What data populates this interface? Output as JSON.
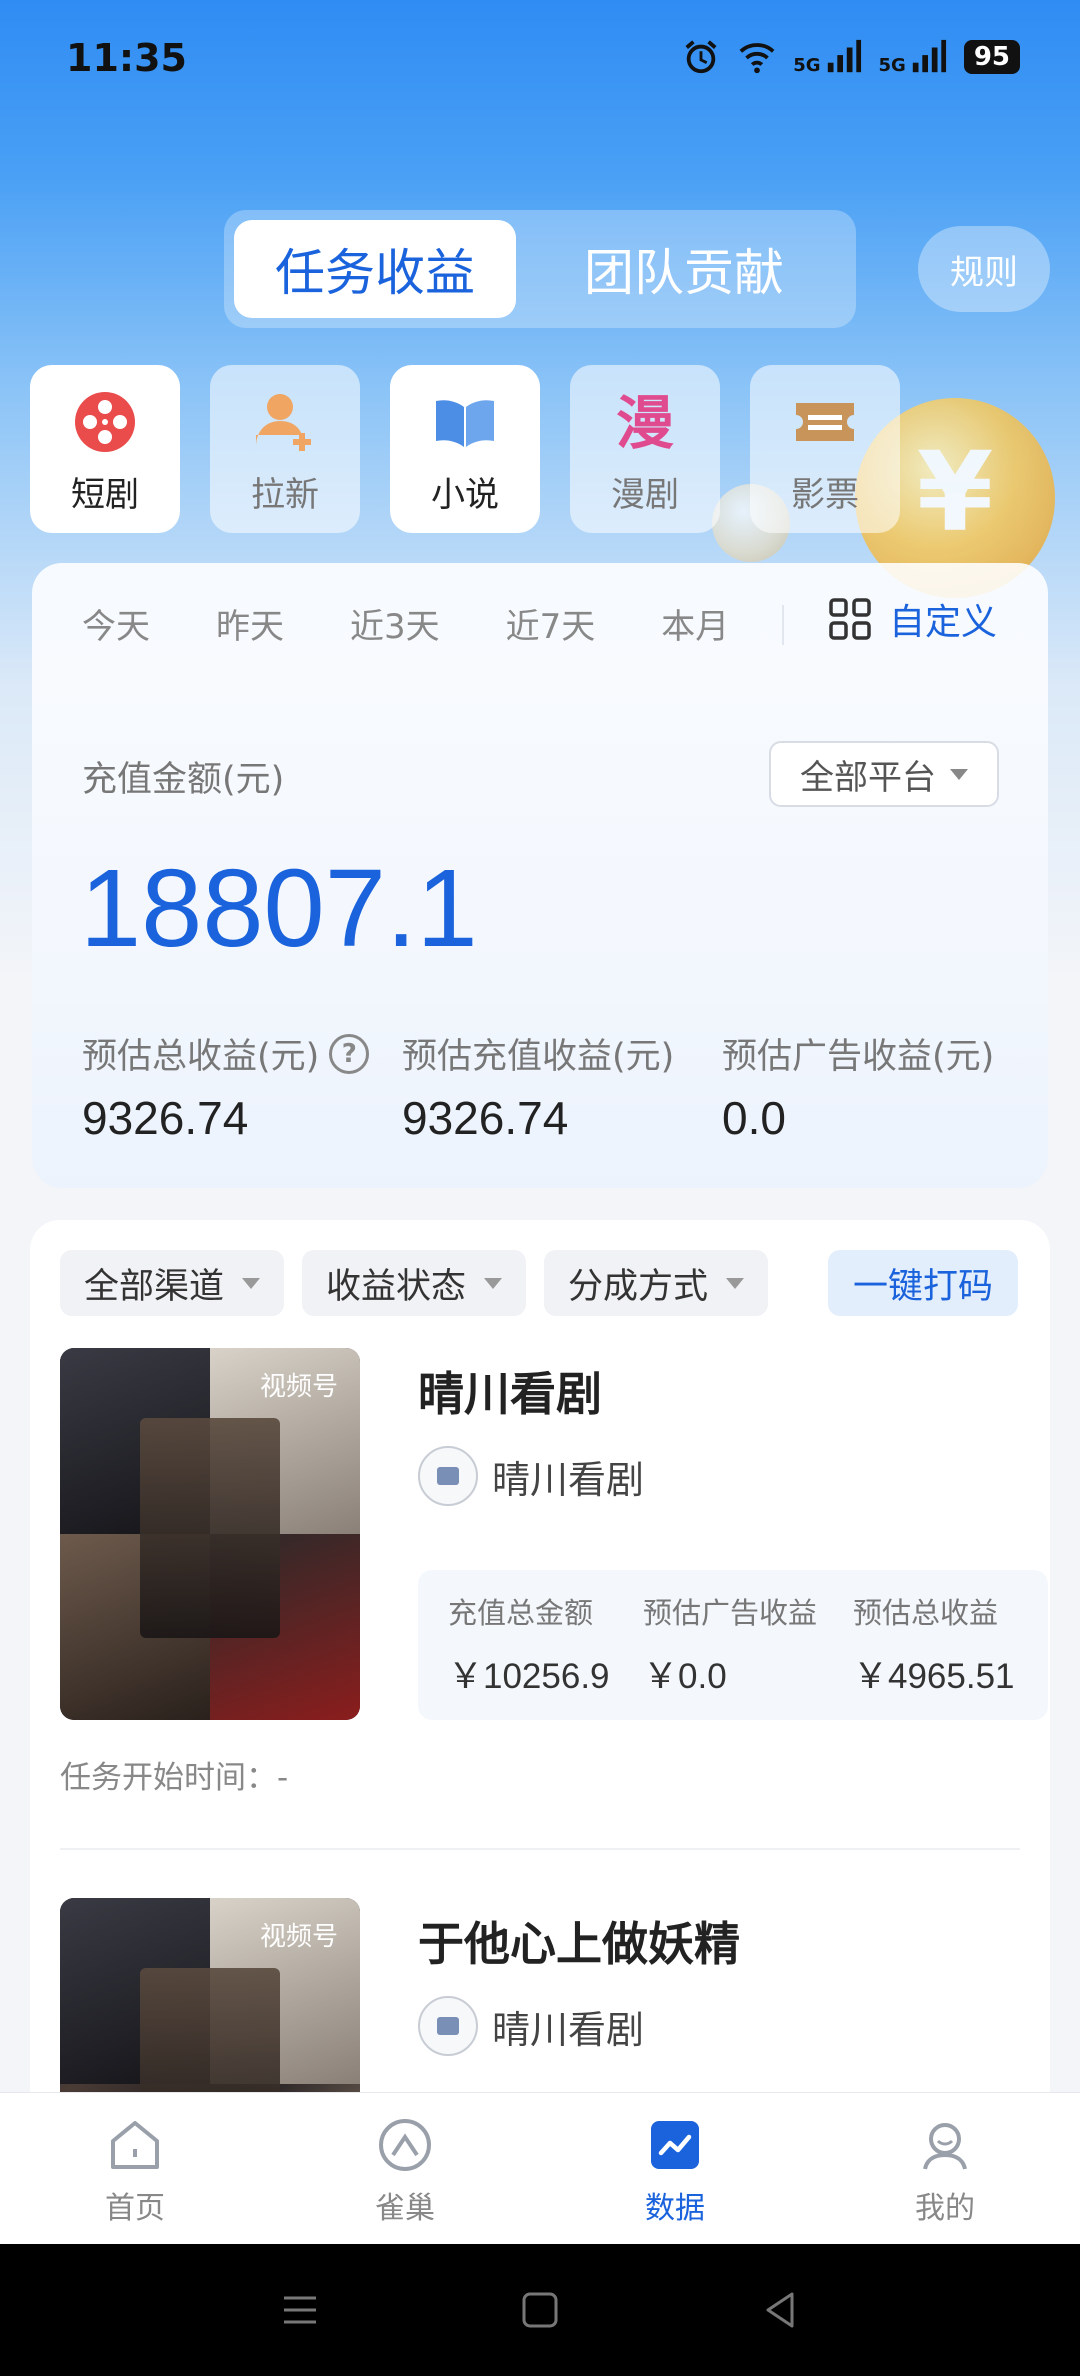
{
  "status_bar": {
    "time": "11:35",
    "battery": "95",
    "net1": "5G",
    "net2": "5G"
  },
  "segment": {
    "active": "任务收益",
    "inactive": "团队贡献",
    "rules": "规则"
  },
  "categories": [
    {
      "label": "短剧",
      "icon": "film-reel-icon",
      "active": true
    },
    {
      "label": "拉新",
      "icon": "add-user-icon",
      "active": false
    },
    {
      "label": "小说",
      "icon": "open-book-icon",
      "active": false
    },
    {
      "label": "漫剧",
      "icon": "comic-icon",
      "active": false
    },
    {
      "label": "影票",
      "icon": "ticket-icon",
      "active": false
    }
  ],
  "coin": "¥",
  "stats": {
    "ranges": [
      "今天",
      "昨天",
      "近3天",
      "近7天",
      "本月"
    ],
    "custom": "自定义",
    "amount_label": "充值金额(元)",
    "platform": "全部平台",
    "amount": "18807.1",
    "estimates": [
      {
        "label": "预估总收益(元)",
        "value": "9326.74"
      },
      {
        "label": "预估充值收益(元)",
        "value": "9326.74"
      },
      {
        "label": "预估广告收益(元)",
        "value": "0.0"
      }
    ]
  },
  "filters": [
    "全部渠道",
    "收益状态",
    "分成方式"
  ],
  "code_button": "一键打码",
  "items": [
    {
      "title": "晴川看剧",
      "badge": "视频号",
      "author": "晴川看剧",
      "metrics": [
        {
          "label": "充值总金额",
          "value": "￥10256.9"
        },
        {
          "label": "预估广告收益",
          "value": "￥0.0"
        },
        {
          "label": "预估总收益",
          "value": "￥4965.51"
        }
      ],
      "start_time": "任务开始时间：-"
    },
    {
      "title": "于他心上做妖精",
      "badge": "视频号",
      "author": "晴川看剧"
    }
  ],
  "nav": [
    {
      "label": "首页",
      "icon": "home-icon"
    },
    {
      "label": "雀巢",
      "icon": "nest-icon"
    },
    {
      "label": "数据",
      "icon": "data-chart-icon",
      "active": true
    },
    {
      "label": "我的",
      "icon": "profile-icon"
    }
  ],
  "colors": {
    "accent": "#1a63dc",
    "header": "#2f8cf3"
  }
}
